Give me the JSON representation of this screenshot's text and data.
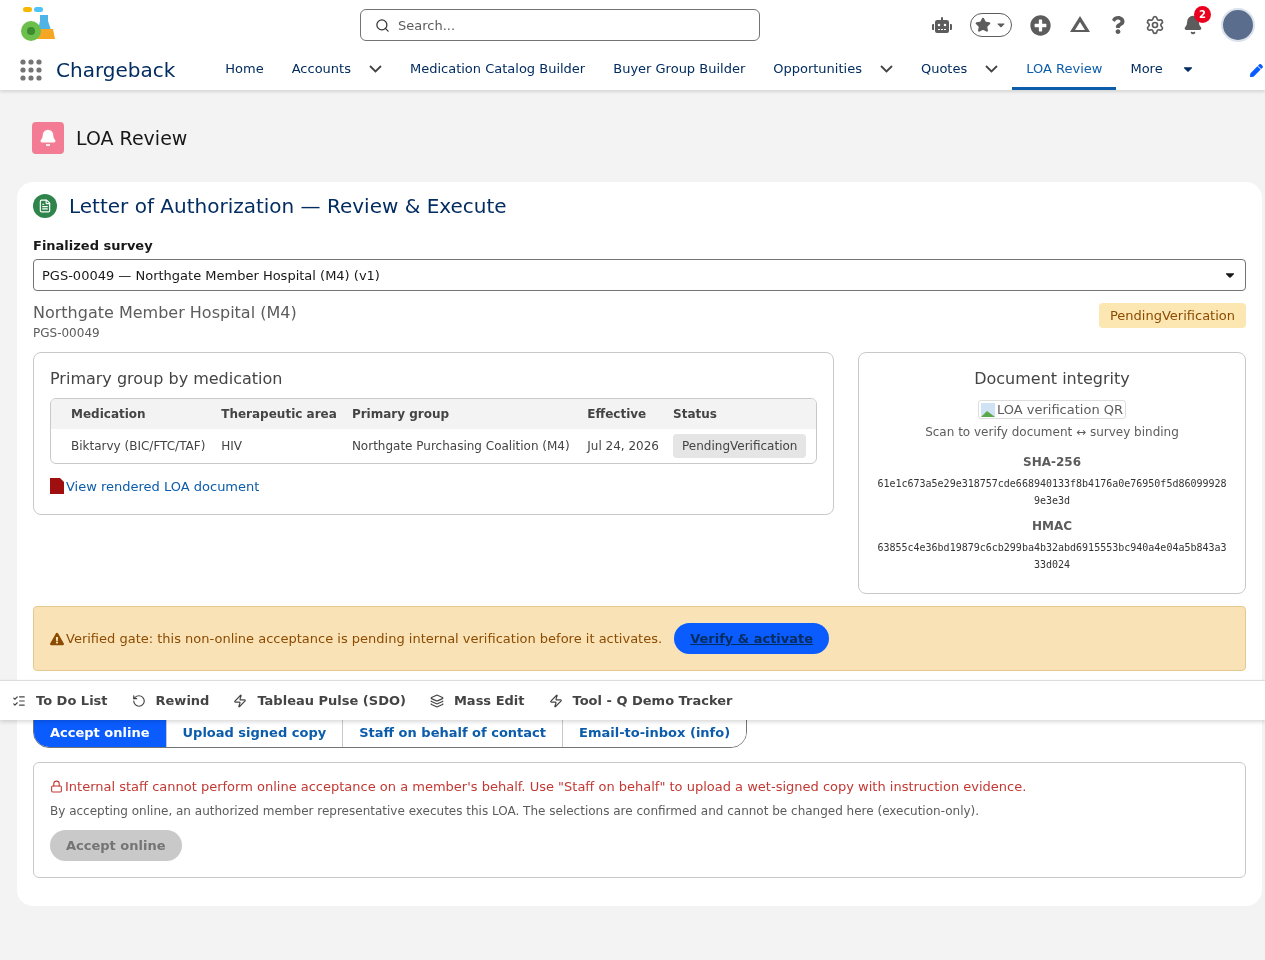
{
  "app": {
    "name": "Chargeback"
  },
  "search": {
    "placeholder": "Search..."
  },
  "notifications": {
    "count": "2"
  },
  "nav": [
    {
      "label": "Home",
      "selected": false,
      "kind": "link"
    },
    {
      "label": "Accounts",
      "selected": false,
      "kind": "menu"
    },
    {
      "label": "Medication Catalog Builder",
      "selected": false,
      "kind": "link"
    },
    {
      "label": "Buyer Group Builder",
      "selected": false,
      "kind": "link"
    },
    {
      "label": "Opportunities",
      "selected": false,
      "kind": "menu"
    },
    {
      "label": "Quotes",
      "selected": false,
      "kind": "menu"
    },
    {
      "label": "LOA Review",
      "selected": true,
      "kind": "link"
    },
    {
      "label": "More",
      "selected": false,
      "kind": "overflow"
    }
  ],
  "page": {
    "title": "LOA Review"
  },
  "card": {
    "title": "Letter of Authorization — Review & Execute",
    "survey_label": "Finalized survey",
    "survey_value": "PGS-00049 — Northgate Member Hospital (M4) (v1)"
  },
  "member": {
    "name": "Northgate Member Hospital (M4)",
    "id": "PGS-00049",
    "status": "PendingVerification"
  },
  "primary_group": {
    "title": "Primary group by medication",
    "columns": [
      "Medication",
      "Therapeutic area",
      "Primary group",
      "Effective",
      "Status"
    ],
    "rows": [
      {
        "cells": [
          "Biktarvy (BIC/FTC/TAF)",
          "HIV",
          "Northgate Purchasing Coalition (M4)",
          "Jul 24, 2026"
        ],
        "status": "PendingVerification"
      }
    ],
    "document_link": "View rendered LOA document"
  },
  "integrity": {
    "title": "Document integrity",
    "qr_alt": "LOA verification QR",
    "caption": "Scan to verify document ↔ survey binding",
    "hashes": [
      {
        "label": "SHA-256",
        "value": "61e1c673a5e29e318757cde668940133f8b4176a0e76950f5d860999289e3e3d"
      },
      {
        "label": "HMAC",
        "value": "63855c4e36bd19879c6cb299ba4b32abd6915553bc940a4e04a5b843a333d024"
      }
    ]
  },
  "gate": {
    "message": "Verified gate: this non-online acceptance is pending internal verification before it activates.",
    "button": "Verify & activate"
  },
  "execution_tabs": [
    {
      "label": "Accept online",
      "selected": true
    },
    {
      "label": "Upload signed copy",
      "selected": false
    },
    {
      "label": "Staff on behalf of contact",
      "selected": false
    },
    {
      "label": "Email-to-inbox (info)",
      "selected": false
    }
  ],
  "execution_panel": {
    "notice": "Internal staff cannot perform online acceptance on a member's behalf. Use \"Staff on behalf\" to upload a wet-signed copy with instruction evidence.",
    "description": "By accepting online, an authorized member representative executes this LOA. The selections are confirmed and cannot be changed here (execution-only).",
    "button": {
      "label": "Accept online",
      "disabled": true
    }
  },
  "utility_bar": [
    {
      "label": "To Do List"
    },
    {
      "label": "Rewind"
    },
    {
      "label": "Tableau Pulse (SDO)"
    },
    {
      "label": "Mass Edit"
    },
    {
      "label": "Tool - Q Demo Tracker"
    }
  ]
}
